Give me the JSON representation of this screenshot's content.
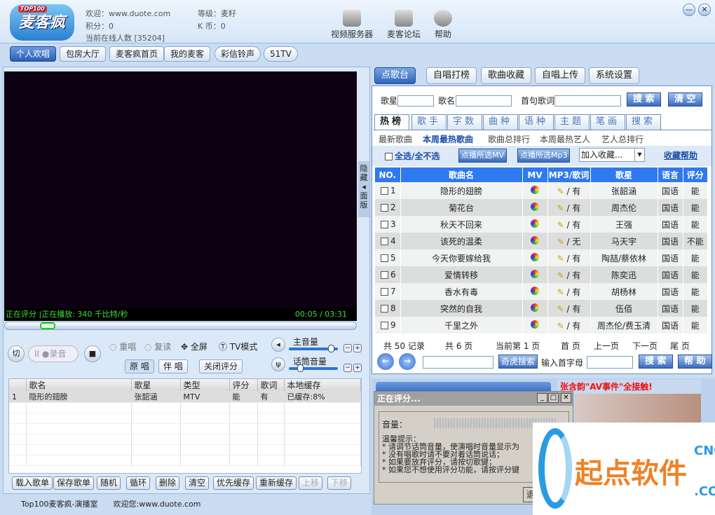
{
  "header": {
    "logo": "麦客疯",
    "logo_badge": "TOP100",
    "welcome": "欢迎：www.duote.com",
    "points": "积分：0",
    "online": "当前在线人数 [35204]",
    "level": "等级：麦籽",
    "kcoin": "K 币：0",
    "icons": [
      {
        "label": "视频服务器",
        "icon": "server-icon"
      },
      {
        "label": "麦客论坛",
        "icon": "forum-icon"
      },
      {
        "label": "帮助",
        "icon": "help-icon"
      }
    ],
    "min": "—",
    "close": "✕"
  },
  "nav": [
    "个人欢唱",
    "包房大厅",
    "麦客疯首页",
    "我的麦客",
    "彩信铃声",
    "51TV"
  ],
  "player": {
    "status": "正在评分 |正在播放: 340 千比特/秒",
    "time": "00:05 /   03:31",
    "hide": "隐藏◂面版",
    "progress": 0.02,
    "cut": "切",
    "pause": "II",
    "record": "●录音",
    "stop": "■",
    "repeat": "重唱",
    "reread": "复读",
    "fullscreen": "全屏",
    "tvmode": "TV模式",
    "original": "原 唱",
    "accomp": "伴 唱",
    "close_score": "关闭评分",
    "main_vol_label": "主音量",
    "mic_vol_label": "话筒音量",
    "main_vol": 0.9,
    "mic_vol": 0.2
  },
  "playlist": {
    "headers": [
      "",
      "歌名",
      "歌星",
      "类型",
      "评分",
      "歌词",
      "本地缓存"
    ],
    "rows": [
      [
        "1",
        "隐形的翅膀",
        "张韶涵",
        "MTV",
        "能",
        "有",
        "已缓存:8%"
      ]
    ]
  },
  "list_buttons": [
    "载入歌单",
    "保存歌单",
    "随机",
    "循环",
    "删除",
    "清空",
    "优先缓存",
    "重新缓存",
    "上移",
    "下移"
  ],
  "footer": {
    "title": "Top100麦客疯-演播室",
    "welcome": "欢迎您:www.duote.com"
  },
  "right_tabs": [
    "点歌台",
    "自唱打榜",
    "歌曲收藏",
    "自唱上传",
    "系统设置"
  ],
  "search": {
    "singer": "歌星",
    "song": "歌名",
    "lyric": "首句歌词",
    "search": "搜 索",
    "clear": "清 空"
  },
  "cat_tabs": [
    "热榜",
    "歌手",
    "字数",
    "曲种",
    "语种",
    "主题",
    "笔画",
    "搜索"
  ],
  "sub_tabs": [
    "最新歌曲",
    "本周最热歌曲",
    "歌曲总排行",
    "本周最热艺人",
    "艺人总排行"
  ],
  "tools": {
    "select_all": "全选/全不选",
    "play_mv": "点播所选MV",
    "play_mp3": "点播所选Mp3",
    "add_fav": "加入收藏...",
    "fav_help": "收藏帮助"
  },
  "songs": {
    "headers": [
      "NO.",
      "歌曲名",
      "MV",
      "MP3/歌词",
      "歌星",
      "语言",
      "评分"
    ],
    "rows": [
      [
        "1",
        "隐形的翅膀",
        "有",
        "张韶涵",
        "国语",
        "能"
      ],
      [
        "2",
        "菊花台",
        "有",
        "周杰伦",
        "国语",
        "能"
      ],
      [
        "3",
        "秋天不回来",
        "有",
        "王强",
        "国语",
        "能"
      ],
      [
        "4",
        "该死的温柔",
        "无",
        "马天宇",
        "国语",
        "不能"
      ],
      [
        "5",
        "今天你要嫁给我",
        "有",
        "陶喆/蔡依林",
        "国语",
        "能"
      ],
      [
        "6",
        "爱情转移",
        "有",
        "陈奕迅",
        "国语",
        "能"
      ],
      [
        "7",
        "香水有毒",
        "有",
        "胡杨林",
        "国语",
        "能"
      ],
      [
        "8",
        "突然的自我",
        "有",
        "伍佰",
        "国语",
        "能"
      ],
      [
        "9",
        "千里之外",
        "有",
        "周杰伦/费玉清",
        "国语",
        "能"
      ]
    ]
  },
  "pager": {
    "total": "共 50 记录",
    "pages": "共 6 页",
    "current": "当前第 1 页",
    "first": "首 页",
    "prev": "上一页",
    "next": "下一页",
    "last": "尾 页",
    "qihu": "奇虎搜索",
    "initial": "输入首字母",
    "search": "搜 索",
    "help": "帮 助"
  },
  "ad": {
    "title": "张含韵\"AV事件\"全接触!"
  },
  "dialog": {
    "title": "正在评分...",
    "volume": "音量：",
    "tips_title": "温馨提示：",
    "tips": [
      "* 请调节话筒音量，使演唱时音量显示为",
      "* 没有唱歌时请不要对着话筒说话；",
      "* 如果要放弃评分，请按切歌键；",
      "* 如果您不想使用评分功能，请按评分键"
    ],
    "button": "退"
  },
  "watermark": {
    "text": "起点软件",
    "cn": "CNC",
    ".com": ".COM"
  }
}
